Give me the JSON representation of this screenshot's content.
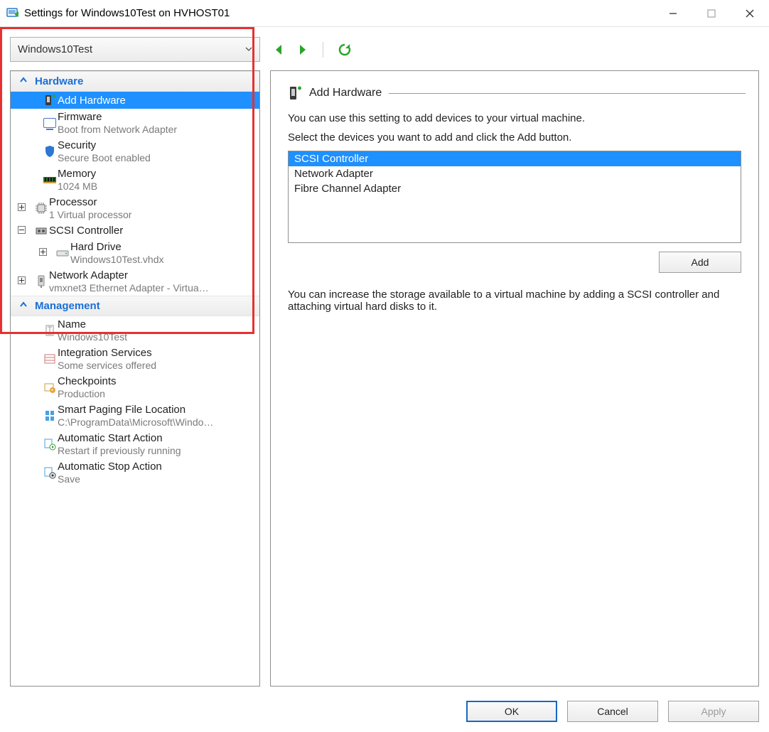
{
  "window": {
    "title": "Settings for Windows10Test on HVHOST01"
  },
  "vmSelector": {
    "value": "Windows10Test"
  },
  "toolbar": {
    "prev": "◀",
    "next": "▶",
    "refresh": "↻"
  },
  "sections": {
    "hardware": {
      "title": "Hardware",
      "items": {
        "addHardware": {
          "label": "Add Hardware"
        },
        "firmware": {
          "label": "Firmware",
          "sub": "Boot from Network Adapter"
        },
        "security": {
          "label": "Security",
          "sub": "Secure Boot enabled"
        },
        "memory": {
          "label": "Memory",
          "sub": "1024 MB"
        },
        "processor": {
          "label": "Processor",
          "sub": "1 Virtual processor"
        },
        "scsi": {
          "label": "SCSI Controller"
        },
        "hardDrive": {
          "label": "Hard Drive",
          "sub": "Windows10Test.vhdx"
        },
        "netAdapter": {
          "label": "Network Adapter",
          "sub": "vmxnet3 Ethernet Adapter - Virtua…"
        }
      }
    },
    "management": {
      "title": "Management",
      "items": {
        "name": {
          "label": "Name",
          "sub": "Windows10Test"
        },
        "integ": {
          "label": "Integration Services",
          "sub": "Some services offered"
        },
        "check": {
          "label": "Checkpoints",
          "sub": "Production"
        },
        "smart": {
          "label": "Smart Paging File Location",
          "sub": "C:\\ProgramData\\Microsoft\\Windo…"
        },
        "astart": {
          "label": "Automatic Start Action",
          "sub": "Restart if previously running"
        },
        "astop": {
          "label": "Automatic Stop Action",
          "sub": "Save"
        }
      }
    }
  },
  "detail": {
    "title": "Add Hardware",
    "intro": "You can use this setting to add devices to your virtual machine.",
    "instruct": "Select the devices you want to add and click the Add button.",
    "devices": [
      "SCSI Controller",
      "Network Adapter",
      "Fibre Channel Adapter"
    ],
    "selectedDevice": "SCSI Controller",
    "addLabel": "Add",
    "note": "You can increase the storage available to a virtual machine by adding a SCSI controller and attaching virtual hard disks to it."
  },
  "buttons": {
    "ok": "OK",
    "cancel": "Cancel",
    "apply": "Apply"
  }
}
